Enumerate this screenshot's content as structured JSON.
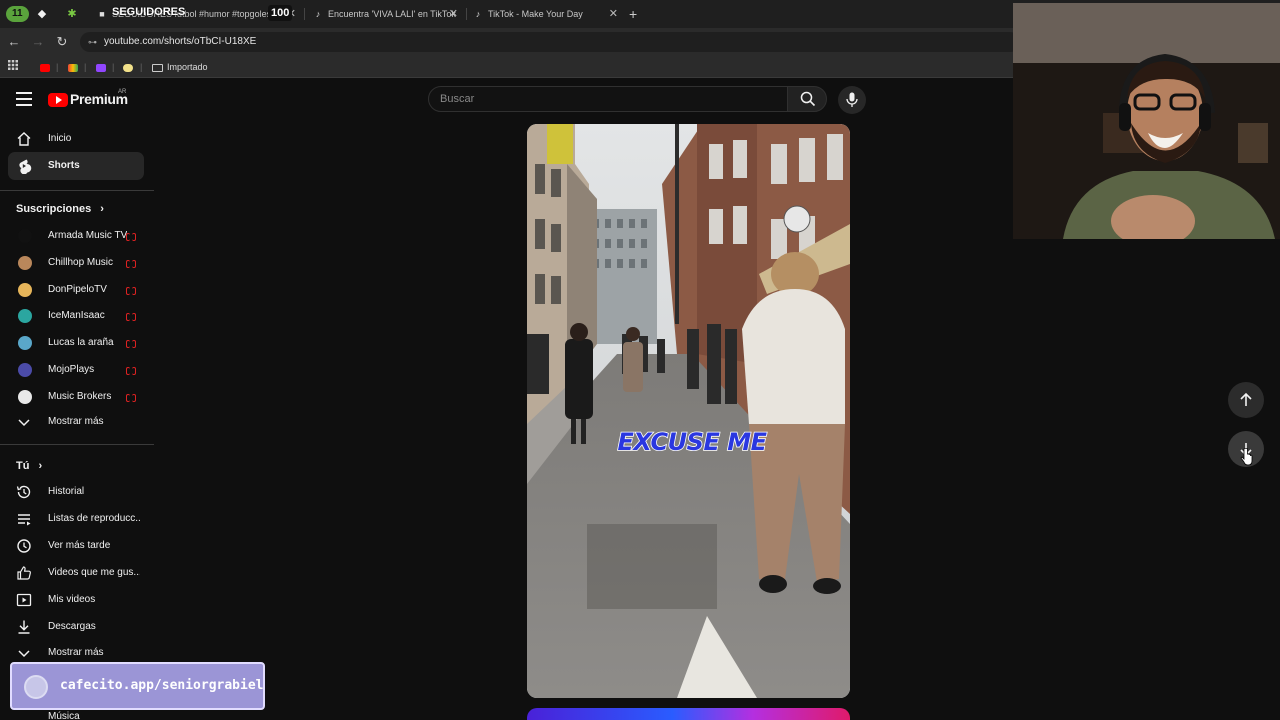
{
  "browser": {
    "tab_group_count": "11",
    "tabs": [
      {
        "title": "SEGUIDORES futbol #humor #topgoles",
        "count": "100"
      },
      {
        "title": "Encuentra 'VIVA LALI' en TikTok"
      },
      {
        "title": "TikTok - Make Your Day"
      }
    ],
    "overlay_label": "SEGUIDORES",
    "url": "youtube.com/shorts/oTbCI-U18XE",
    "bookmarks": {
      "folder_label": "Importado"
    }
  },
  "header": {
    "logo_text": "Premium",
    "country_code": "AR",
    "search_placeholder": "Buscar"
  },
  "sidebar": {
    "main": [
      {
        "label": "Inicio",
        "icon": "home-icon"
      },
      {
        "label": "Shorts",
        "icon": "shorts-icon",
        "active": true
      }
    ],
    "subscriptions_heading": "Suscripciones",
    "subscriptions": [
      {
        "label": "Armada Music TV",
        "avatar_color": "#111111",
        "live": true
      },
      {
        "label": "Chillhop Music",
        "avatar_color": "#b9875b",
        "live": true
      },
      {
        "label": "DonPipeloTV",
        "avatar_color": "#e6b55a",
        "live": true
      },
      {
        "label": "IceManIsaac",
        "avatar_color": "#2ba6a0",
        "live": true
      },
      {
        "label": "Lucas la araña",
        "avatar_color": "#5aa7c9",
        "live": true
      },
      {
        "label": "MojoPlays",
        "avatar_color": "#4b4ba8",
        "live": true
      },
      {
        "label": "Music Brokers",
        "avatar_color": "#e8e8e8",
        "live": true
      }
    ],
    "show_more_1": "Mostrar más",
    "you_heading": "Tú",
    "you_items": [
      {
        "label": "Historial",
        "icon": "history-icon"
      },
      {
        "label": "Listas de reproducc...",
        "icon": "playlists-icon"
      },
      {
        "label": "Ver más tarde",
        "icon": "clock-icon"
      },
      {
        "label": "Videos que me gus...",
        "icon": "thumbs-up-icon"
      },
      {
        "label": "Mis videos",
        "icon": "my-videos-icon"
      },
      {
        "label": "Descargas",
        "icon": "download-icon"
      }
    ],
    "show_more_2": "Mostrar más",
    "music_label": "Música"
  },
  "video": {
    "caption": "EXCUSE ME"
  },
  "stream_overlay": {
    "donation_url": "cafecito.app/seniorgrabiel"
  },
  "colors": {
    "brand_red": "#ff0000",
    "caption_blue": "#2a37e0",
    "banner": "#9b95d6"
  }
}
